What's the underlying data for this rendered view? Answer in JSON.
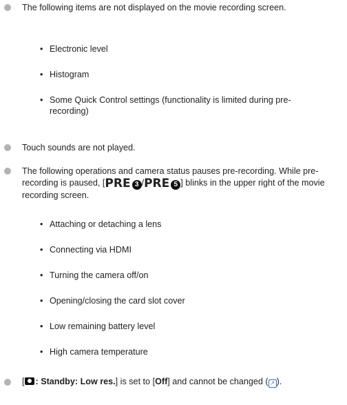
{
  "items": {
    "not_displayed": "The following items are not displayed on the movie recording screen.",
    "not_displayed_list": [
      "Electronic level",
      "Histogram",
      "Some Quick Control settings (functionality is limited during pre-recording)"
    ],
    "touch_sounds": "Touch sounds are not played.",
    "pauses_intro": "The following operations and camera status pauses pre-recording.",
    "pauses_blink_prefix": "While pre-recording is paused, [",
    "pre_label_1": "PRE",
    "pre_num_1": "3",
    "pre_sep": "/",
    "pre_label_2": "PRE",
    "pre_num_2": "5",
    "pauses_blink_suffix": "] blinks in the upper right of the movie recording screen.",
    "pauses_list": [
      "Attaching or detaching a lens",
      "Connecting via HDMI",
      "Turning the camera off/on",
      "Opening/closing the card slot cover",
      "Low remaining battery level",
      "High camera temperature"
    ],
    "standby_open": "[",
    "standby_label": "Standby: Low res.",
    "standby_mid": "] is set to [",
    "standby_value": "Off",
    "standby_tail": "] and cannot be changed",
    "standby_ref_open": "(",
    "standby_ref_close": ")."
  },
  "colors": {
    "bullet": "#b3b3b3",
    "text": "#222222",
    "link": "#3a67b8"
  }
}
